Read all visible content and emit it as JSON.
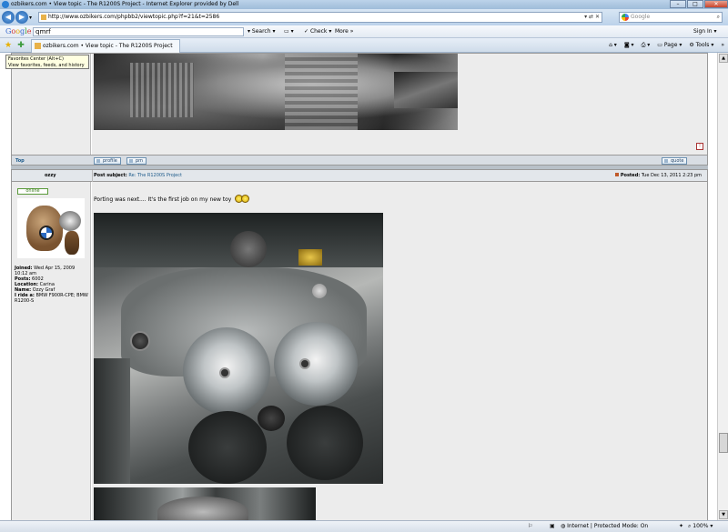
{
  "window": {
    "title": "ozbikers.com • View topic - The R1200S Project - Internet Explorer provided by Dell"
  },
  "address": {
    "url": "http://www.ozbikers.com/phpbb2/viewtopic.php?f=21&t=2586"
  },
  "search": {
    "placeholder": "Google"
  },
  "google_toolbar": {
    "logo": "Google",
    "query": "qmrf",
    "search_label": "Search",
    "check_label": "Check",
    "more_label": "More »",
    "signin_label": "Sign In"
  },
  "tab": {
    "label": "ozbikers.com • View topic - The R1200S Project"
  },
  "tab_tools": {
    "page_label": "Page",
    "tools_label": "Tools"
  },
  "tooltip": {
    "line1": "Favorites Center (Alt+C)",
    "line2": "View favorites, feeds, and history"
  },
  "post_prev": {
    "top_link": "Top",
    "profile_btn": "profile",
    "pm_btn": "pm",
    "quote_btn": "quote"
  },
  "post": {
    "author": "ozzy",
    "subject_label": "Post subject:",
    "subject": "Re: The R1200S Project",
    "posted_label": "Posted:",
    "posted": "Tue Dec 13, 2011 2:23 pm",
    "online_badge": "online",
    "message": "Porting was next.... It's the first job on my new toy",
    "details": [
      {
        "label": "Joined:",
        "value": "Wed Apr 15, 2009 10:12 am"
      },
      {
        "label": "Posts:",
        "value": "6002"
      },
      {
        "label": "Location:",
        "value": "Carina"
      },
      {
        "label": "Name:",
        "value": "Ozzy Graf"
      },
      {
        "label": "I ride a:",
        "value": "BMW F900R-CPE; BMW R1200-S"
      }
    ]
  },
  "statusbar": {
    "zone": "Internet | Protected Mode: On",
    "zoom": "100%"
  },
  "colors": {
    "header_bg": "#d8dde3",
    "post_bg": "#ececec",
    "link": "#1c5a8a"
  }
}
